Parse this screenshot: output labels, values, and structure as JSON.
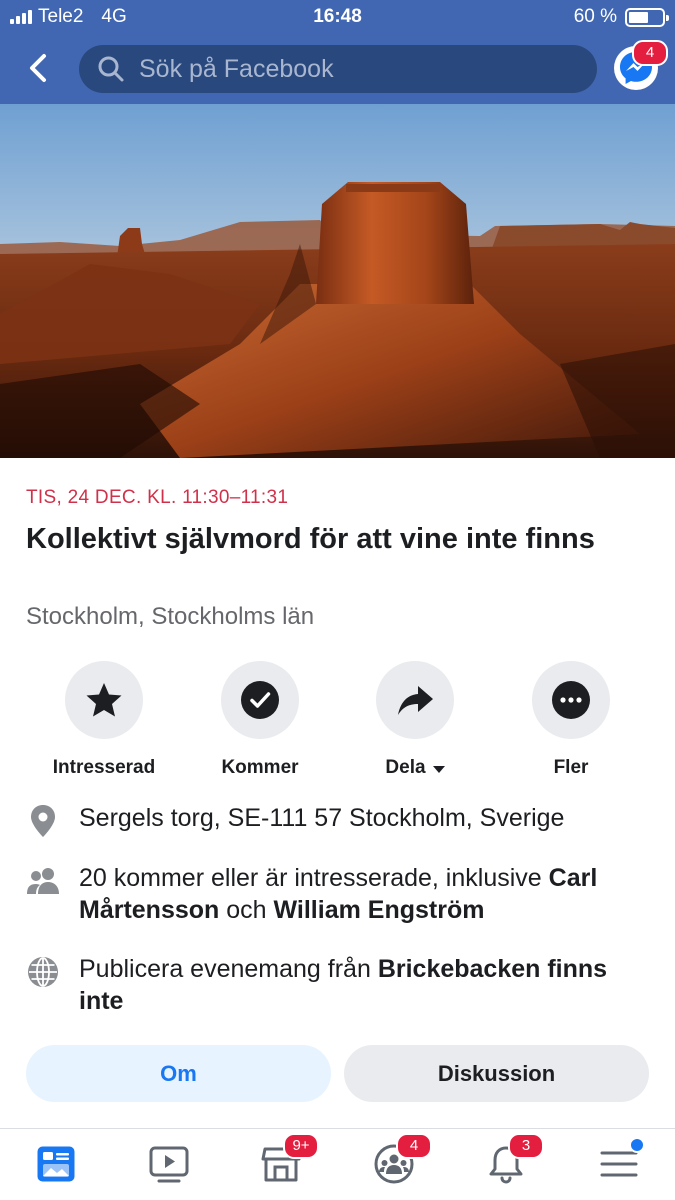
{
  "status_bar": {
    "carrier": "Tele2",
    "network": "4G",
    "time": "16:48",
    "battery_text": "60 %",
    "battery_level": 0.6
  },
  "header": {
    "search_placeholder": "Sök på Facebook",
    "messenger_badge": "4"
  },
  "event": {
    "date_time": "TIS, 24 DEC. KL. 11:30–11:31",
    "title": "Kollektivt självmord för att vine inte finns",
    "location": "Stockholm, Stockholms län"
  },
  "actions": [
    {
      "label": "Intresserad",
      "icon": "star-icon"
    },
    {
      "label": "Kommer",
      "icon": "check-circle-icon"
    },
    {
      "label": "Dela",
      "icon": "share-arrow-icon"
    },
    {
      "label": "Fler",
      "icon": "more-dots-icon"
    }
  ],
  "details": {
    "address": "Sergels torg, SE-111 57 Stockholm, Sverige",
    "attendance_prefix": "20 kommer eller är intresserade, inklusive",
    "attendee_1": "Carl Mårtensson",
    "attendance_joiner": "och",
    "attendee_2": "William Engström",
    "publish_prefix": "Publicera evenemang från",
    "publisher": "Brickebacken finns inte"
  },
  "tabs": [
    {
      "label": "Om",
      "active": true
    },
    {
      "label": "Diskussion",
      "active": false
    }
  ],
  "bottom_nav": {
    "items": [
      {
        "icon": "news-feed-icon",
        "badge": ""
      },
      {
        "icon": "watch-video-icon",
        "badge": ""
      },
      {
        "icon": "marketplace-icon",
        "badge": "9+"
      },
      {
        "icon": "groups-icon",
        "badge": "4"
      },
      {
        "icon": "notifications-bell-icon",
        "badge": "3"
      },
      {
        "icon": "menu-icon",
        "badge": ""
      }
    ]
  },
  "colors": {
    "brand_blue": "#4267b2",
    "search_bg": "#29487d",
    "date_red": "#d0314a",
    "badge_red": "#e41e3f",
    "active_blue": "#1877f2"
  }
}
